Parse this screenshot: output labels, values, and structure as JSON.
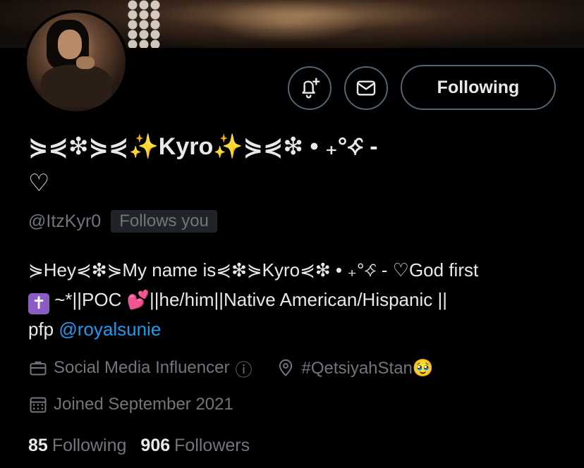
{
  "profile": {
    "display_name": "⋟⋞❇⋟⋞✨Kyro✨⋟⋞❇ • ₊°⟡̑ -",
    "display_name_heart": "♡",
    "handle": "@ItzKyr0",
    "follows_you_label": "Follows you",
    "bio_line1": "⋟Hey⋞❇⋟My name is⋞❇⋟Kyro⋞❇ • ₊°⟡̑ - ♡God first",
    "bio_cross": "✝",
    "bio_line2": " ~*||POC 💕||he/him||Native American/Hispanic ||",
    "bio_pfp_prefix": "pfp ",
    "bio_mention": "@royalsunie",
    "category": "Social Media Influencer",
    "category_info_icon": "ⓘ",
    "location": "#QetsiyahStan🥹",
    "joined": "Joined September 2021",
    "following_count": "85",
    "following_label": "Following",
    "followers_count": "906",
    "followers_label": "Followers"
  },
  "actions": {
    "notify_icon": "bell-plus-icon",
    "message_icon": "envelope-icon",
    "follow_button_label": "Following"
  },
  "colors": {
    "background": "#000000",
    "text_primary": "#e7e9ea",
    "text_secondary": "#71767b",
    "link": "#1d9bf0",
    "border": "#536471"
  }
}
